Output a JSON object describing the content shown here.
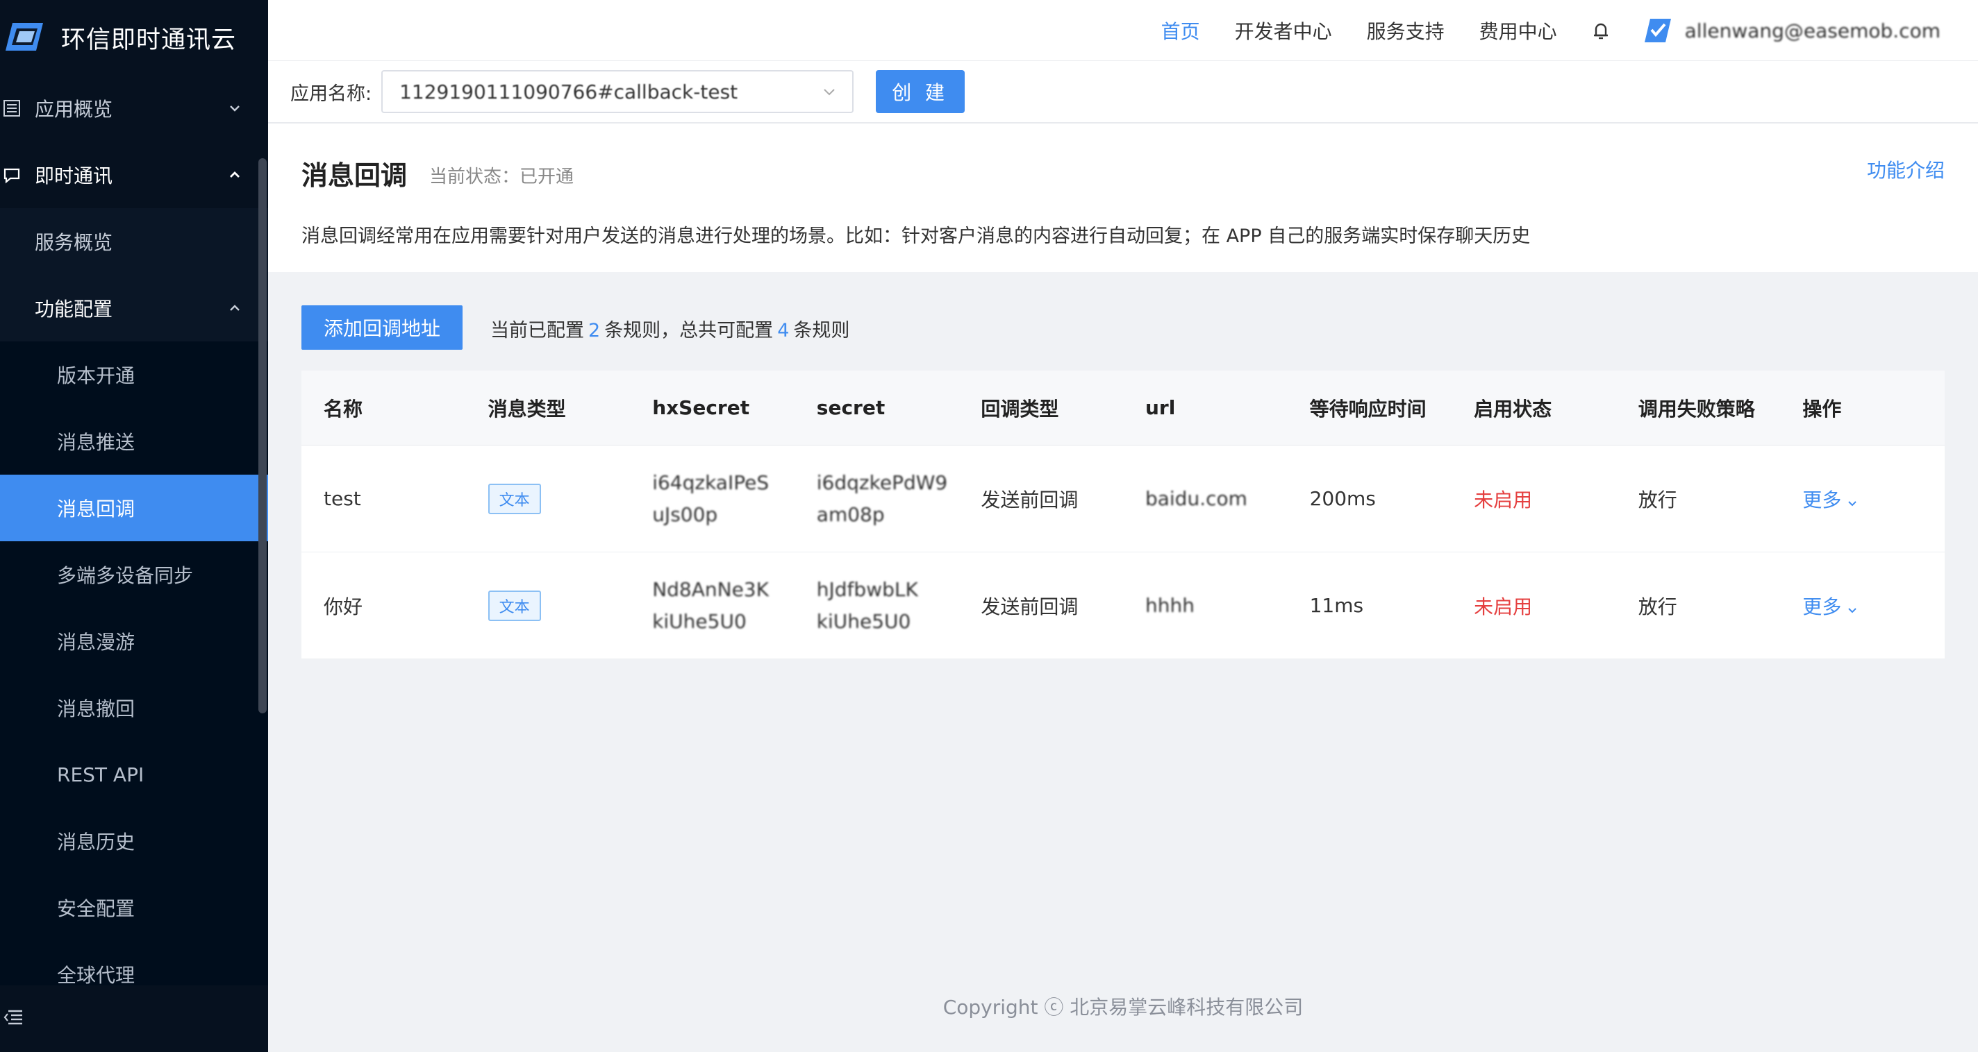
{
  "brand": {
    "title": "环信即时通讯云"
  },
  "sidebar": {
    "items": [
      {
        "label": "应用概览"
      },
      {
        "label": "即时通讯"
      },
      {
        "label": "服务概览"
      },
      {
        "label": "功能配置"
      },
      {
        "label": "版本开通"
      },
      {
        "label": "消息推送"
      },
      {
        "label": "消息回调"
      },
      {
        "label": "多端多设备同步"
      },
      {
        "label": "消息漫游"
      },
      {
        "label": "消息撤回"
      },
      {
        "label": "REST API"
      },
      {
        "label": "消息历史"
      },
      {
        "label": "安全配置"
      },
      {
        "label": "全球代理"
      }
    ]
  },
  "topnav": {
    "home": "首页",
    "developer": "开发者中心",
    "support": "服务支持",
    "billing": "费用中心",
    "email": "allenwang@easemob.com"
  },
  "appbar": {
    "label": "应用名称:",
    "app_value": "1129190111090766#callback-test",
    "create": "创 建"
  },
  "header": {
    "title": "消息回调",
    "status": "当前状态：已开通",
    "intro_link": "功能介绍",
    "description": "消息回调经常用在应用需要针对用户发送的消息进行处理的场景。比如：针对客户消息的内容进行自动回复；在 APP 自己的服务端实时保存聊天历史"
  },
  "actions": {
    "add_button": "添加回调地址",
    "rules_prefix": "当前已配置",
    "configured": "2",
    "rules_mid": "条规则，总共可配置",
    "total": "4",
    "rules_suffix": "条规则"
  },
  "table": {
    "columns": [
      "名称",
      "消息类型",
      "hxSecret",
      "secret",
      "回调类型",
      "url",
      "等待响应时间",
      "启用状态",
      "调用失败策略",
      "操作"
    ],
    "rows": [
      {
        "name": "test",
        "msg_type": "文本",
        "hx_secret": "i64qzkaIPeS uJs00p",
        "secret": "i6dqzkePdW9 am08p",
        "callback_type": "发送前回调",
        "url": "baidu.com",
        "timeout": "200ms",
        "enabled": "未启用",
        "fail_policy": "放行",
        "op": "更多"
      },
      {
        "name": "你好",
        "msg_type": "文本",
        "hx_secret": "Nd8AnNe3K kiUhe5U0",
        "secret": "hJdfbwbLK kiUhe5U0",
        "callback_type": "发送前回调",
        "url": "hhhh",
        "timeout": "11ms",
        "enabled": "未启用",
        "fail_policy": "放行",
        "op": "更多"
      }
    ]
  },
  "footer": {
    "copyright": "Copyright ⓒ 北京易掌云峰科技有限公司"
  },
  "colors": {
    "accent": "#3f8cf0",
    "sidebar_bg": "#0d1a2d",
    "danger": "#e53f3f"
  }
}
